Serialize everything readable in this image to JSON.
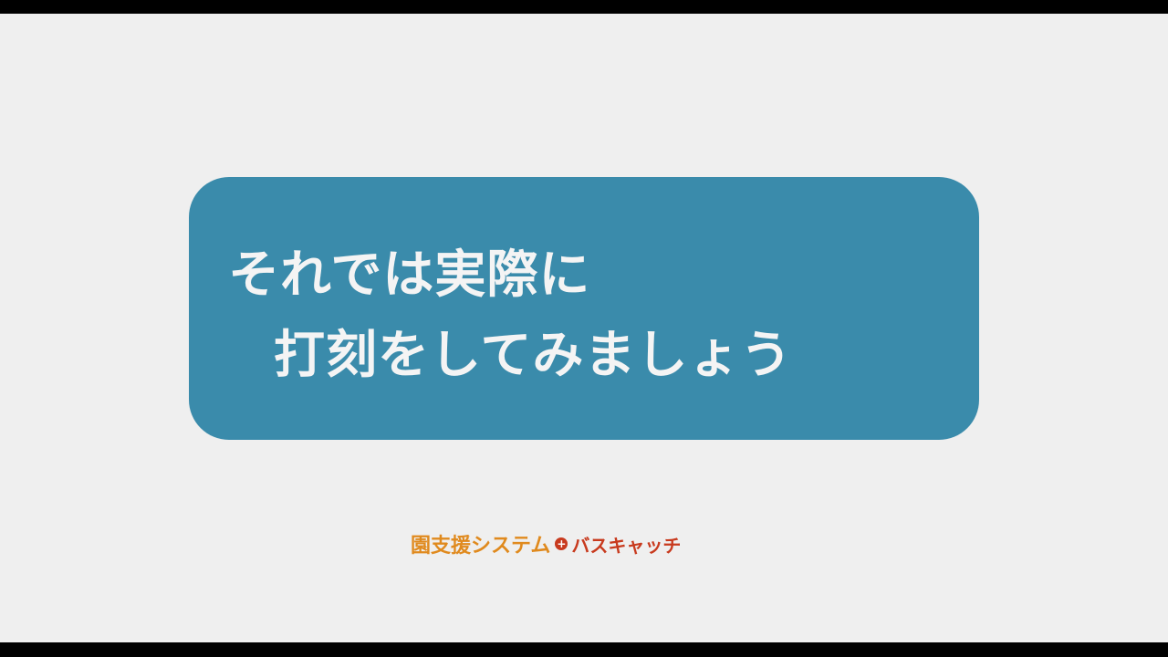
{
  "message": {
    "line1": "それでは実際に",
    "line2": "打刻をしてみましょう"
  },
  "logo": {
    "part_a": "園支援システム",
    "plus": "+",
    "part_b": "バスキャッチ"
  },
  "colors": {
    "background": "#efefef",
    "card": "#3a8bab",
    "card_text": "#f4f4f4",
    "logo_orange": "#e08a1e",
    "logo_red": "#c83a1e"
  }
}
